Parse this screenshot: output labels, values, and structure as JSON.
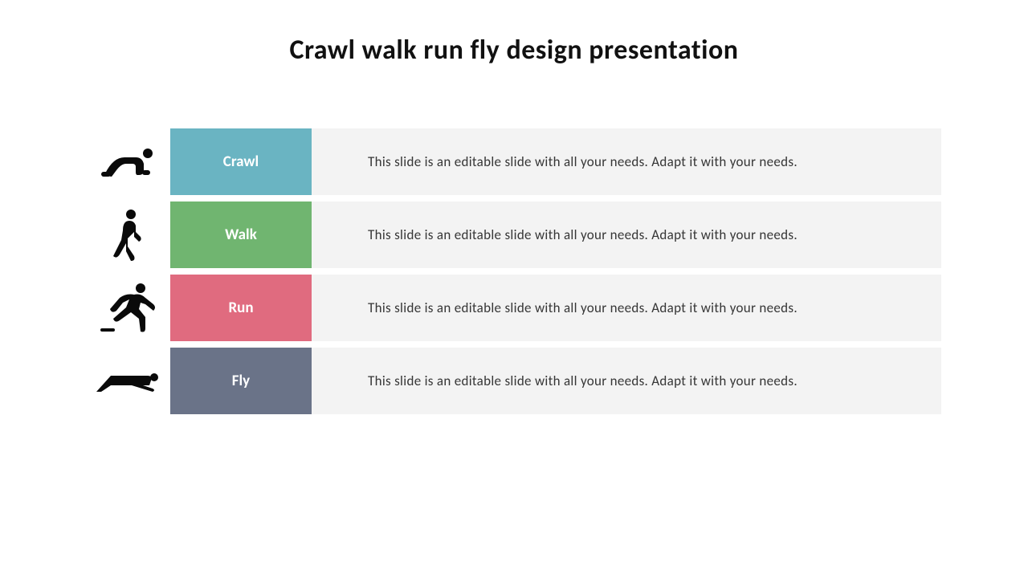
{
  "title": "Crawl walk run fly design presentation",
  "colors": {
    "crawl": "#6ab4c2",
    "walk": "#70b570",
    "run": "#e06b7f",
    "fly": "#6a7388"
  },
  "rows": [
    {
      "label": "Crawl",
      "description": "This slide is an editable slide with all your needs.  Adapt it with your needs."
    },
    {
      "label": "Walk",
      "description": "This slide is an editable slide with all your needs.  Adapt it with your needs."
    },
    {
      "label": "Run",
      "description": "This slide is an editable slide with all your needs.  Adapt it with your needs."
    },
    {
      "label": "Fly",
      "description": "This slide is an editable slide with all your needs.  Adapt it with your needs."
    }
  ]
}
